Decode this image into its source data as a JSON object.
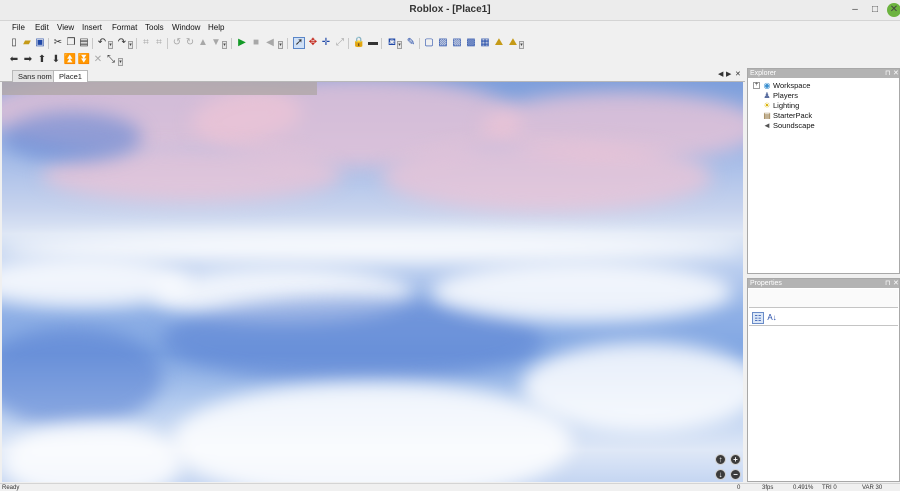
{
  "window": {
    "title": "Roblox - [Place1]"
  },
  "menu": [
    "File",
    "Edit",
    "View",
    "Insert",
    "Format",
    "Tools",
    "Window",
    "Help"
  ],
  "tabs": [
    "Sans nom",
    "Place1"
  ],
  "explorer": {
    "title": "Explorer",
    "items": [
      "Workspace",
      "Players",
      "Lighting",
      "StarterPack",
      "Soundscape"
    ]
  },
  "properties": {
    "title": "Properties"
  },
  "status": [
    "Ready",
    "0",
    "3fps",
    "0.491%",
    "TRI 0",
    "VAR 30"
  ]
}
